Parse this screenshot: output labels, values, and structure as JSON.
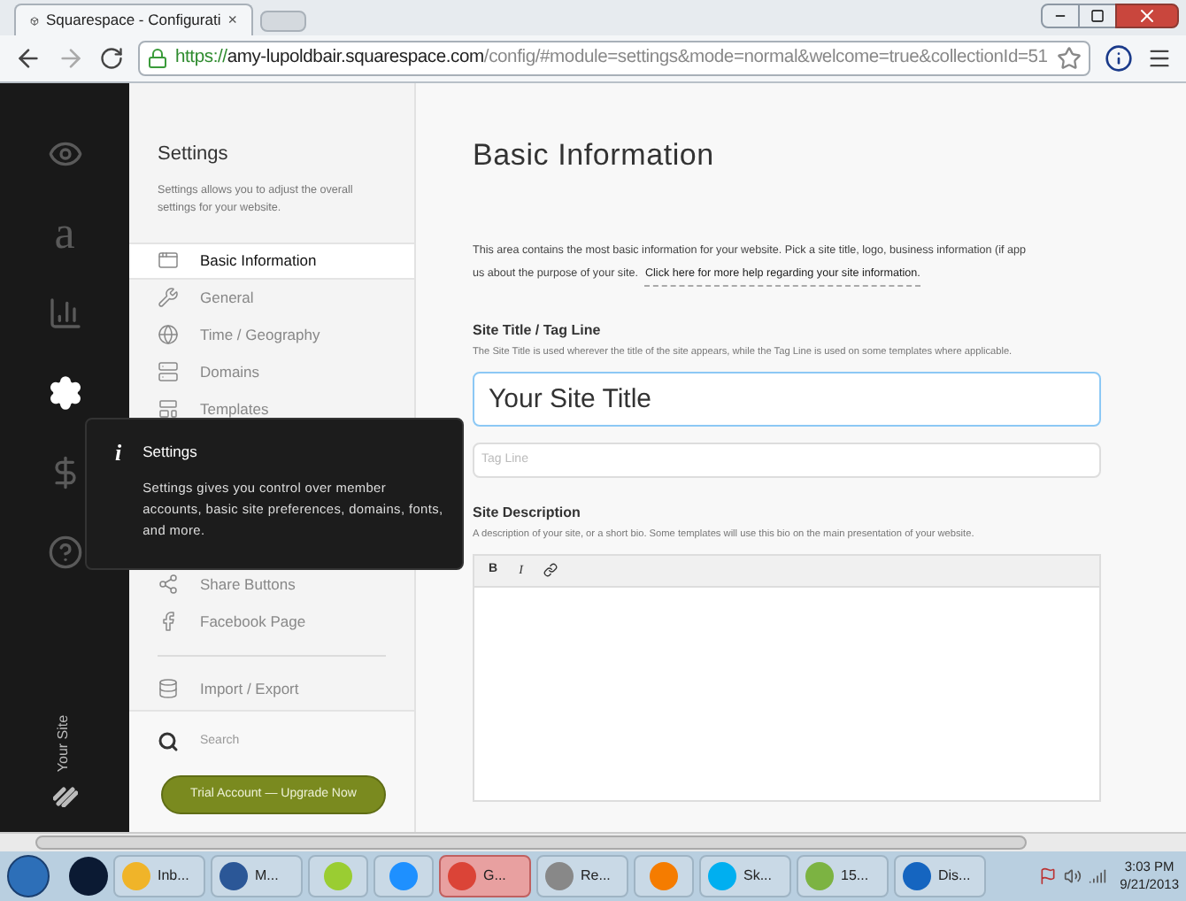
{
  "browser": {
    "tab": {
      "title": "Squarespace - Configurati",
      "close": "×"
    },
    "address": {
      "scheme": "https://",
      "host": "amy-lupoldbair.squarespace.com",
      "path": "/config/#module=settings&mode=normal&welcome=true&collectionId=51"
    }
  },
  "rail": {
    "items": [
      {
        "kind": "eye",
        "selected": false
      },
      {
        "kind": "glyph",
        "glyph": "a",
        "selected": false
      },
      {
        "kind": "chart",
        "selected": false
      },
      {
        "kind": "gear",
        "selected": true
      },
      {
        "kind": "dollar",
        "selected": false
      },
      {
        "kind": "help",
        "selected": false
      }
    ],
    "site_label": "Your Site"
  },
  "panel": {
    "title": "Settings",
    "description": "Settings allows you to adjust the overall settings for your website.",
    "items": [
      {
        "kind": "window",
        "label": "Basic Information",
        "selected": true
      },
      {
        "kind": "wrench",
        "label": "General",
        "selected": false
      },
      {
        "kind": "globe",
        "label": "Time / Geography",
        "selected": false
      },
      {
        "kind": "domain",
        "label": "Domains",
        "selected": false
      },
      {
        "kind": "template",
        "label": "Templates",
        "selected": false
      }
    ],
    "lower_items": [
      {
        "kind": "share",
        "label": "Share Buttons",
        "selected": false
      },
      {
        "kind": "facebook",
        "label": "Facebook Page",
        "selected": false
      }
    ],
    "bottom_items": [
      {
        "kind": "database",
        "label": "Import / Export",
        "selected": false
      }
    ],
    "search": {
      "placeholder": "Search"
    },
    "upgrade_button": "Trial Account — Upgrade Now"
  },
  "tooltip": {
    "icon": "i",
    "title": "Settings",
    "text": "Settings gives you control over member accounts, basic site preferences, domains, fonts, and more."
  },
  "main": {
    "title": "Basic Information",
    "intro": "This area contains the most basic information for your website. Pick a site title, logo, business information (if app",
    "intro_line2": "us about the purpose of your site.",
    "help_link": "Click here for more help regarding your site information.",
    "site_title": {
      "label": "Site Title / Tag Line",
      "hint": "The Site Title is used wherever the title of the site appears, while the Tag Line is used on some templates where applicable.",
      "value": "Your Site Title",
      "focused": true
    },
    "tag_line": {
      "placeholder": "Tag Line"
    },
    "description": {
      "label": "Site Description",
      "hint": "A description of your site, or a short bio. Some templates will use this bio on the main presentation of your website.",
      "toolbar": [
        "B",
        "I"
      ]
    }
  },
  "taskbar": {
    "items": [
      {
        "kind": "outlook",
        "label": "Inb...",
        "selected": false
      },
      {
        "kind": "word",
        "label": "M...",
        "selected": false
      },
      {
        "kind": "notes",
        "selected": false
      },
      {
        "kind": "ie",
        "selected": false
      },
      {
        "kind": "chrome",
        "label": "G...",
        "selected": true
      },
      {
        "kind": "drive",
        "label": "Re...",
        "selected": false
      },
      {
        "kind": "media",
        "selected": false
      },
      {
        "kind": "skype",
        "label": "Sk...",
        "selected": false
      },
      {
        "kind": "paint",
        "label": "15...",
        "selected": false
      },
      {
        "kind": "display",
        "label": "Dis...",
        "selected": false
      }
    ],
    "time": "3:03 PM",
    "date": "9/21/2013"
  }
}
